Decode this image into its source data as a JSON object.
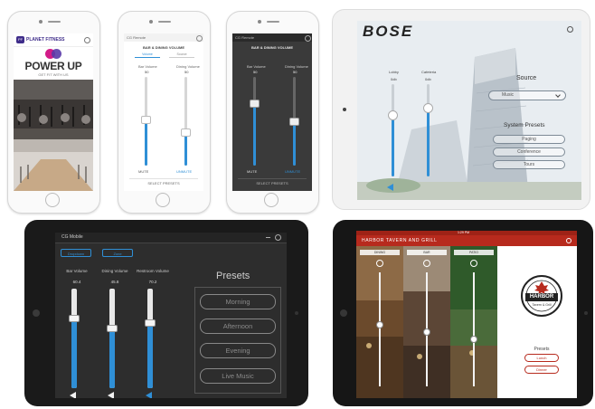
{
  "phone1": {
    "brand": "PLANET FITNESS",
    "logo_small": "PF",
    "headline": "POWER UP",
    "subhead": "GET FIT WITH US"
  },
  "phone2": {
    "title": "CG Remote",
    "heading": "BAR & DINING VOLUME",
    "tabs": [
      "Volume",
      "Source"
    ],
    "slider_labels": [
      "Bar Volume",
      "Dining Volume"
    ],
    "slider_values": [
      "50",
      "50"
    ],
    "mute_labels": [
      "MUTE",
      "UNMUTE"
    ],
    "footer": "SELECT PRESETS"
  },
  "phone3": {
    "title": "CG Remote",
    "heading": "BAR & DINING VOLUME",
    "slider_labels": [
      "Bar Volume",
      "Dining Volume"
    ],
    "slider_values": [
      "50",
      "50"
    ],
    "mute_labels": [
      "MUTE",
      "UNMUTE"
    ],
    "footer": "SELECT PRESETS"
  },
  "bose": {
    "logo": "BOSE",
    "slider_labels": [
      "Lobby",
      "Cafeteria"
    ],
    "slider_values": [
      "0db",
      "0db"
    ],
    "source_label": "Source",
    "source_value": "Music",
    "presets_label": "System Presets",
    "presets": [
      "Paging",
      "Conference",
      "Tours"
    ]
  },
  "dark_tablet": {
    "title": "CG Mobile",
    "top_buttons": [
      "Dropdown",
      "Zone"
    ],
    "slider_labels": [
      "Bar Volume",
      "Dining Volume",
      "Restroom Volume"
    ],
    "slider_values": [
      "60.4",
      "45.8",
      "70.2"
    ],
    "slider_levels": [
      0.7,
      0.6,
      0.65
    ],
    "presets_title": "Presets",
    "presets": [
      "Morning",
      "Afternoon",
      "Evening",
      "Live Music"
    ]
  },
  "harbor": {
    "title": "HARBOR TAVERN AND GRILL",
    "time": "1:29 PM",
    "column_labels": [
      "DINING",
      "BAR",
      "PATIO"
    ],
    "logo_name": "HARBOR",
    "logo_sub": "Tavern & Grill",
    "presets_label": "Presets",
    "presets": [
      "Lunch",
      "Dinner"
    ]
  },
  "colors": {
    "slider_blue": "#2f8fd6",
    "harbor_red": "#b72a1d",
    "dark_bg": "#2d2d2d"
  }
}
